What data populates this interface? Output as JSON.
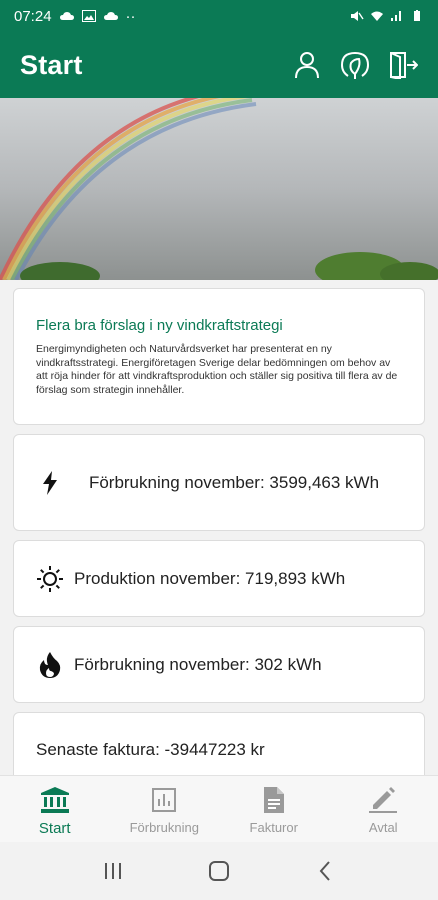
{
  "status": {
    "time": "07:24",
    "dots": "··"
  },
  "app": {
    "title": "Start"
  },
  "news": {
    "title": "Flera bra förslag i ny vindkraftstrategi",
    "body": "Energimyndigheten och Naturvårdsverket har presenterat en ny vindkraftsstrategi. Energiföretagen Sverige delar bedömningen om behov av att röja hinder för att vindkraftsproduktion och ställer sig positiva till flera av de förslag som strategin innehåller."
  },
  "stats": [
    {
      "icon": "lightning-icon",
      "text": "Förbrukning november:  3599,463 kWh"
    },
    {
      "icon": "sun-icon",
      "text": "Produktion november:  719,893 kWh"
    },
    {
      "icon": "flame-icon",
      "text": "Förbrukning november:  302 kWh"
    },
    {
      "icon": "",
      "text": "Senaste faktura: -39447223 kr"
    }
  ],
  "nav": [
    {
      "icon": "bank-icon",
      "label": "Start",
      "active": true
    },
    {
      "icon": "chart-icon",
      "label": "Förbrukning",
      "active": false
    },
    {
      "icon": "document-icon",
      "label": "Fakturor",
      "active": false
    },
    {
      "icon": "pen-icon",
      "label": "Avtal",
      "active": false
    }
  ],
  "colors": {
    "primary": "#0b7a55",
    "inactive": "#9a9a9a"
  }
}
